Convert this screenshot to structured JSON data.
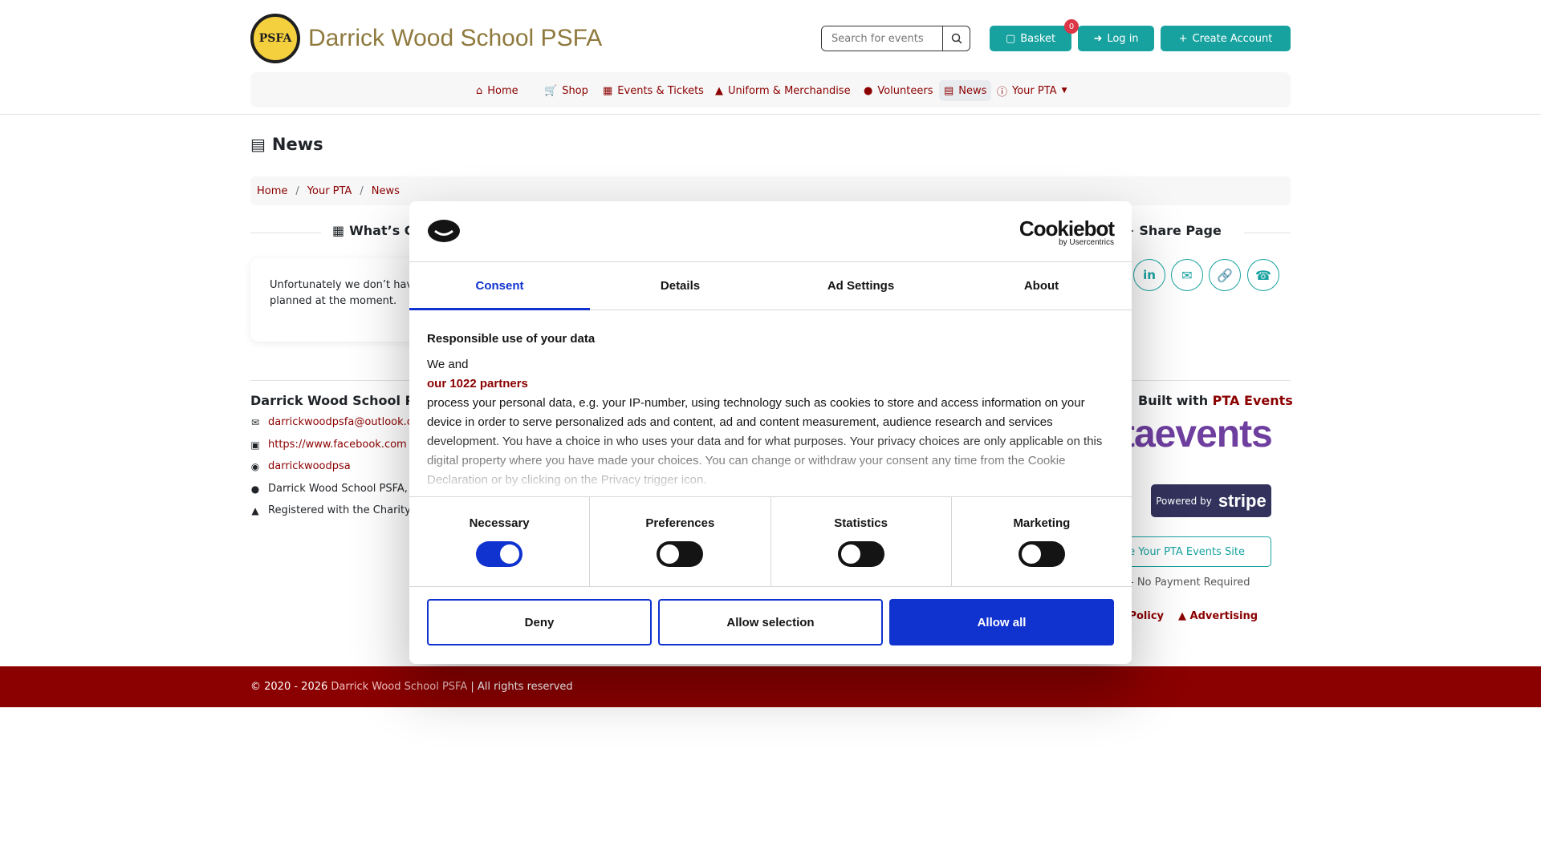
{
  "header": {
    "site_name": "Darrick Wood School PSFA",
    "logo_text": "PSFA",
    "search_placeholder": "Search for events",
    "basket_label": "Basket",
    "basket_count": "0",
    "login_label": "Log in",
    "create_account_label": "Create Account"
  },
  "nav": {
    "items": [
      {
        "label": "Home",
        "icon": "home-icon"
      },
      {
        "label": "Shop",
        "icon": "cart-icon"
      },
      {
        "label": "Events & Tickets",
        "icon": "calendar-icon"
      },
      {
        "label": "Uniform & Merchandise",
        "icon": "tshirt-icon"
      },
      {
        "label": "Volunteers",
        "icon": "users-icon"
      },
      {
        "label": "News",
        "icon": "newspaper-icon"
      },
      {
        "label": "Your PTA",
        "icon": "info-icon"
      }
    ]
  },
  "page": {
    "title": "News",
    "breadcrumb": [
      "Home",
      "Your PTA",
      "News"
    ],
    "whats_on_heading": "What’s On",
    "share_heading": "Share Page",
    "no_events_text": "Unfortunately we don’t have any events planned at the moment."
  },
  "footer": {
    "org_title": "Darrick Wood School PSFA",
    "email": "darrickwoodpsfa@outlook.com",
    "facebook": "https://www.facebook.com",
    "instagram": "darrickwoodpsa",
    "address": "Darrick Wood School PSFA, L",
    "charity": "Registered with the Charity",
    "built_with_prefix": "Built with",
    "built_with_brand": "PTA Events",
    "pta_logo_text": "taevents",
    "stripe_prefix": "Powered by",
    "stripe_brand": "stripe",
    "create_site_label": "ate Your PTA Events Site",
    "minutes_text": "tes - No Payment Required",
    "cookie_policy_label": "kie Policy",
    "advertising_label": "Advertising",
    "copyright_prefix": "© 2020 - 2026",
    "copyright_org": "Darrick Wood School PSFA",
    "copyright_suffix": "| All rights reserved"
  },
  "cookie_dialog": {
    "brand": "Cookiebot",
    "brand_sub": "by Usercentrics",
    "tabs": [
      "Consent",
      "Details",
      "Ad Settings",
      "About"
    ],
    "heading": "Responsible use of your data",
    "intro": "We and",
    "partners": "our 1022 partners",
    "body": "process your personal data, e.g. your IP-number, using technology such as cookies to store and access information on your device in order to serve personalized ads and content, ad and content measurement, audience research and services development. You have a choice in who uses your data and for what purposes. Your privacy choices are only applicable on this digital property where you have made your choices. You can change or withdraw your consent any time from the Cookie Declaration or by clicking on the Privacy trigger icon.",
    "toggles": [
      {
        "label": "Necessary",
        "on": true
      },
      {
        "label": "Preferences",
        "on": false
      },
      {
        "label": "Statistics",
        "on": false
      },
      {
        "label": "Marketing",
        "on": false
      }
    ],
    "deny_label": "Deny",
    "allow_selection_label": "Allow selection",
    "allow_all_label": "Allow all"
  },
  "colors": {
    "brand_red": "#8b0000",
    "teal": "#17a2a0",
    "cookiebot_blue": "#1032cf"
  }
}
